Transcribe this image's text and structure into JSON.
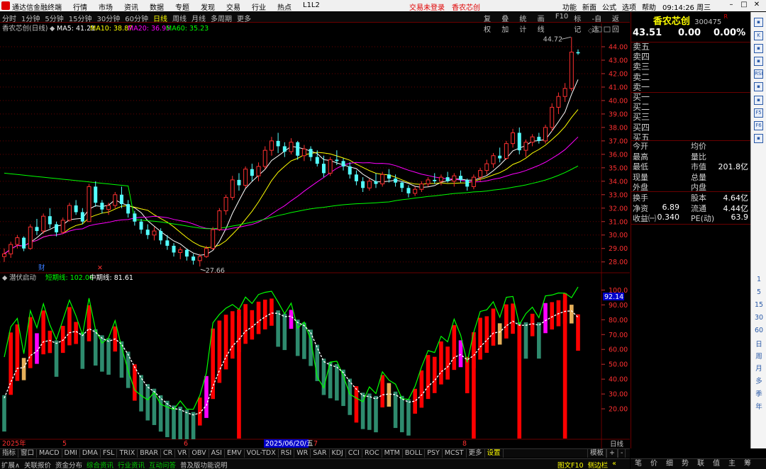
{
  "titlebar": {
    "app_name": "通达信金融终端",
    "menu": [
      "行情",
      "市场",
      "资讯",
      "数据",
      "专题",
      "发现",
      "交易",
      "行业",
      "热点",
      "L1L2"
    ],
    "trade_status": "交易未登录",
    "stock_title": "香农芯创",
    "right_menu": [
      "功能",
      "新面",
      "公式",
      "选项",
      "帮助"
    ],
    "clock": "09:14:26 周三",
    "window_controls": [
      "–",
      "□",
      "✕"
    ]
  },
  "toolbar": {
    "periods": [
      "分时",
      "1分钟",
      "5分钟",
      "15分钟",
      "30分钟",
      "60分钟",
      "日线",
      "周线",
      "月线",
      "多周期",
      "更多"
    ],
    "active_period": 6,
    "right_items": [
      "复权",
      "叠加",
      "统计",
      "画线",
      "F10",
      "标记",
      "-自选",
      "返回"
    ]
  },
  "main_chart": {
    "stock_label": "香农芯创(日线)",
    "ma_legend": [
      {
        "label": "MA5: 41.21",
        "color": "#ffffff"
      },
      {
        "label": "MA10: 38.87",
        "color": "#ffff00"
      },
      {
        "label": "MA20: 36.95",
        "color": "#ff00ff"
      },
      {
        "label": "MA60: 35.23",
        "color": "#00ff00"
      }
    ],
    "high_label": "44.72",
    "low_label": "27.66",
    "y_ticks": [
      "44.00",
      "43.00",
      "42.00",
      "41.00",
      "40.00",
      "39.00",
      "38.00",
      "37.00",
      "36.00",
      "35.00",
      "34.00",
      "33.00",
      "32.00",
      "31.00",
      "30.00",
      "29.00",
      "28.00"
    ],
    "markers": [
      "财",
      "✕"
    ]
  },
  "indicator": {
    "name": "潜伏启动",
    "legend": [
      {
        "label": "短期线: 102.06",
        "color": "#00ff00"
      },
      {
        "label": "中期线: 81.61",
        "color": "#ffffff"
      }
    ],
    "current_value": "92.14",
    "y_ticks": [
      "100.0",
      "90.00",
      "80.00",
      "70.00",
      "60.00",
      "50.00",
      "40.00",
      "30.00",
      "20.00"
    ],
    "axis_label": "日线"
  },
  "x_axis": {
    "labels": [
      "2025年",
      "5",
      "6",
      "2025/06/20/五",
      "7",
      "8"
    ]
  },
  "colors": {
    "up": "#ff3030",
    "down": "#54ffff",
    "grid": "#6a0000",
    "bar_tan": "#e6b05a",
    "bar_teal": "#2e8b6e",
    "bar_red": "#ff0000",
    "bar_magenta": "#ff00ff",
    "bar_yellow": "#ffff00"
  },
  "chart_data": [
    {
      "type": "candlestick",
      "title": "香农芯创(日线)",
      "x": [
        "2025年",
        "5",
        "6",
        "2025/06/20/五",
        "7",
        "8"
      ],
      "ohlc": [
        [
          28.4,
          29.0,
          28.0,
          28.6
        ],
        [
          28.6,
          29.5,
          28.3,
          29.3
        ],
        [
          29.3,
          30.0,
          29.0,
          29.8
        ],
        [
          29.8,
          29.9,
          28.8,
          29.0
        ],
        [
          29.0,
          30.8,
          28.9,
          30.6
        ],
        [
          30.6,
          31.2,
          30.0,
          30.3
        ],
        [
          30.3,
          31.6,
          30.1,
          31.4
        ],
        [
          31.4,
          32.0,
          30.5,
          30.8
        ],
        [
          30.8,
          31.0,
          29.9,
          30.2
        ],
        [
          30.2,
          31.3,
          30.1,
          31.1
        ],
        [
          31.1,
          32.4,
          31.0,
          32.2
        ],
        [
          32.2,
          32.6,
          31.5,
          31.7
        ],
        [
          31.7,
          32.0,
          30.8,
          31.0
        ],
        [
          31.0,
          33.8,
          31.0,
          33.6
        ],
        [
          33.6,
          34.0,
          32.1,
          32.4
        ],
        [
          32.4,
          32.6,
          31.6,
          31.9
        ],
        [
          31.9,
          32.4,
          31.5,
          32.2
        ],
        [
          32.2,
          33.2,
          32.0,
          33.0
        ],
        [
          33.0,
          33.6,
          32.0,
          32.3
        ],
        [
          32.3,
          32.6,
          31.3,
          31.6
        ],
        [
          31.6,
          31.8,
          30.7,
          31.0
        ],
        [
          31.0,
          31.2,
          30.1,
          30.4
        ],
        [
          30.4,
          30.8,
          29.7,
          30.0
        ],
        [
          30.0,
          30.6,
          29.6,
          30.3
        ],
        [
          30.3,
          30.5,
          29.3,
          29.6
        ],
        [
          29.6,
          30.0,
          28.9,
          29.2
        ],
        [
          29.2,
          29.4,
          28.4,
          28.7
        ],
        [
          28.7,
          29.1,
          28.2,
          28.9
        ],
        [
          28.9,
          29.0,
          28.1,
          28.4
        ],
        [
          28.4,
          28.6,
          27.8,
          28.1
        ],
        [
          28.1,
          28.6,
          27.66,
          28.4
        ],
        [
          28.4,
          29.2,
          28.3,
          29.0
        ],
        [
          29.0,
          30.6,
          28.9,
          30.4
        ],
        [
          30.4,
          32.0,
          30.3,
          31.8
        ],
        [
          31.8,
          33.0,
          31.5,
          32.8
        ],
        [
          32.8,
          34.4,
          32.6,
          34.1
        ],
        [
          34.1,
          34.6,
          33.3,
          33.7
        ],
        [
          33.7,
          35.1,
          33.5,
          34.9
        ],
        [
          34.9,
          35.3,
          34.0,
          34.4
        ],
        [
          34.4,
          35.4,
          34.0,
          35.1
        ],
        [
          35.1,
          36.6,
          34.9,
          36.3
        ],
        [
          36.3,
          37.3,
          35.9,
          37.0
        ],
        [
          37.0,
          37.6,
          36.1,
          36.6
        ],
        [
          36.6,
          36.9,
          35.8,
          36.2
        ],
        [
          36.2,
          37.2,
          36.0,
          36.9
        ],
        [
          36.9,
          37.0,
          35.6,
          35.9
        ],
        [
          35.9,
          36.7,
          35.5,
          36.4
        ],
        [
          36.4,
          36.6,
          35.5,
          35.8
        ],
        [
          35.8,
          36.3,
          35.1,
          35.3
        ],
        [
          35.3,
          35.9,
          34.3,
          34.6
        ],
        [
          34.6,
          35.8,
          34.4,
          35.6
        ],
        [
          35.6,
          36.3,
          35.2,
          35.5
        ],
        [
          35.5,
          35.7,
          34.8,
          35.1
        ],
        [
          35.1,
          35.4,
          34.2,
          34.5
        ],
        [
          34.5,
          34.8,
          33.7,
          34.0
        ],
        [
          34.0,
          34.3,
          33.2,
          33.5
        ],
        [
          33.5,
          34.2,
          33.3,
          34.0
        ],
        [
          34.0,
          34.6,
          33.5,
          33.8
        ],
        [
          33.8,
          34.7,
          33.6,
          34.5
        ],
        [
          34.5,
          34.9,
          33.9,
          34.2
        ],
        [
          34.2,
          34.5,
          33.6,
          33.9
        ],
        [
          33.9,
          34.0,
          33.2,
          33.5
        ],
        [
          33.5,
          33.7,
          32.8,
          33.1
        ],
        [
          33.1,
          33.6,
          32.9,
          33.4
        ],
        [
          33.4,
          34.0,
          33.2,
          33.8
        ],
        [
          33.8,
          34.3,
          33.6,
          34.1
        ],
        [
          34.1,
          34.6,
          33.8,
          34.0
        ],
        [
          34.0,
          34.5,
          33.7,
          34.3
        ],
        [
          34.3,
          34.7,
          33.9,
          34.0
        ],
        [
          34.0,
          34.6,
          33.6,
          34.4
        ],
        [
          34.4,
          34.8,
          33.9,
          34.1
        ],
        [
          34.1,
          34.2,
          33.3,
          33.6
        ],
        [
          33.6,
          34.5,
          33.4,
          34.3
        ],
        [
          34.3,
          35.0,
          34.0,
          34.8
        ],
        [
          34.8,
          35.6,
          34.5,
          35.3
        ],
        [
          35.3,
          36.1,
          35.0,
          35.9
        ],
        [
          35.9,
          36.5,
          35.4,
          35.7
        ],
        [
          35.7,
          37.0,
          35.6,
          36.8
        ],
        [
          36.8,
          37.9,
          36.5,
          37.6
        ],
        [
          37.6,
          38.0,
          36.0,
          36.3
        ],
        [
          36.3,
          37.1,
          35.8,
          36.9
        ],
        [
          36.9,
          37.5,
          36.6,
          37.3
        ],
        [
          37.3,
          37.6,
          36.8,
          37.0
        ],
        [
          37.0,
          38.2,
          36.8,
          38.0
        ],
        [
          38.0,
          39.8,
          37.7,
          39.5
        ],
        [
          39.5,
          40.6,
          39.0,
          40.3
        ],
        [
          40.3,
          41.3,
          39.9,
          40.9
        ],
        [
          40.9,
          44.72,
          40.7,
          43.6
        ],
        [
          43.6,
          43.8,
          43.4,
          43.51
        ]
      ],
      "series": [
        {
          "name": "MA5",
          "values": [
            41.21
          ]
        },
        {
          "name": "MA10",
          "values": [
            38.87
          ]
        },
        {
          "name": "MA20",
          "values": [
            36.95
          ]
        },
        {
          "name": "MA60",
          "values": [
            35.23
          ]
        }
      ],
      "ylim": [
        27.3,
        45.0
      ]
    },
    {
      "type": "bar",
      "title": "潜伏启动",
      "series": [
        {
          "name": "短期线",
          "values": [
            102.06
          ]
        },
        {
          "name": "中期线",
          "values": [
            81.61
          ]
        }
      ],
      "ylim": [
        0,
        104
      ]
    }
  ],
  "quote": {
    "name": "香农芯创",
    "code": "300475",
    "badge": "R",
    "price": "43.51",
    "change": "0.00",
    "change_pct": "0.00%",
    "asks": [
      "卖五",
      "卖四",
      "卖三",
      "卖二",
      "卖一"
    ],
    "bids": [
      "买一",
      "买二",
      "买三",
      "买四",
      "买五"
    ],
    "stats_a": [
      {
        "k1": "今开",
        "v1": "",
        "k2": "均价",
        "v2": ""
      },
      {
        "k1": "最高",
        "v1": "",
        "k2": "量比",
        "v2": ""
      },
      {
        "k1": "最低",
        "v1": "",
        "k2": "市值",
        "v2": "201.8亿"
      },
      {
        "k1": "现量",
        "v1": "",
        "k2": "总量",
        "v2": ""
      },
      {
        "k1": "外盘",
        "v1": "",
        "k2": "内盘",
        "v2": ""
      }
    ],
    "stats_b": [
      {
        "k1": "换手",
        "v1": "",
        "k2": "股本",
        "v2": "4.64亿"
      },
      {
        "k1": "净资",
        "v1": "6.89",
        "k2": "流通",
        "v2": "4.44亿"
      },
      {
        "k1": "收益㈠",
        "v1": "0.340",
        "k2": "PE(动)",
        "v2": "63.9"
      }
    ]
  },
  "strip": {
    "icons": [
      "bar-chart-icon",
      "K",
      "line-chart-icon",
      "candle-icon",
      "RSI",
      "pen-icon",
      "grid-icon",
      "F5",
      "F6",
      "table-icon"
    ],
    "labels": [
      "1",
      "5",
      "15",
      "30",
      "60",
      "日",
      "周",
      "月",
      "多",
      "季",
      "年"
    ]
  },
  "tabs": {
    "items": [
      "指标",
      "窗口",
      "MACD",
      "DMI",
      "DMA",
      "FSL",
      "TRIX",
      "BRAR",
      "CR",
      "VR",
      "OBV",
      "ASI",
      "EMV",
      "VOL-TDX",
      "RSI",
      "WR",
      "SAR",
      "KDJ",
      "CCI",
      "ROC",
      "MTM",
      "BOLL",
      "PSY",
      "MCST",
      "更多",
      "设置"
    ],
    "active": 25,
    "right": [
      "模板",
      "+",
      "-"
    ]
  },
  "bottom": {
    "left": [
      "扩展∧",
      "关联报价",
      "资金分布",
      "综合资讯",
      "行业资讯",
      "互动问答",
      "普及版功能说明"
    ],
    "green_indices": [
      3,
      4,
      5
    ],
    "right": [
      "图文F10",
      "侧边栏",
      "«"
    ],
    "panel_tabs": [
      "笔",
      "价",
      "细",
      "势",
      "联",
      "值",
      "主",
      "筹"
    ]
  }
}
